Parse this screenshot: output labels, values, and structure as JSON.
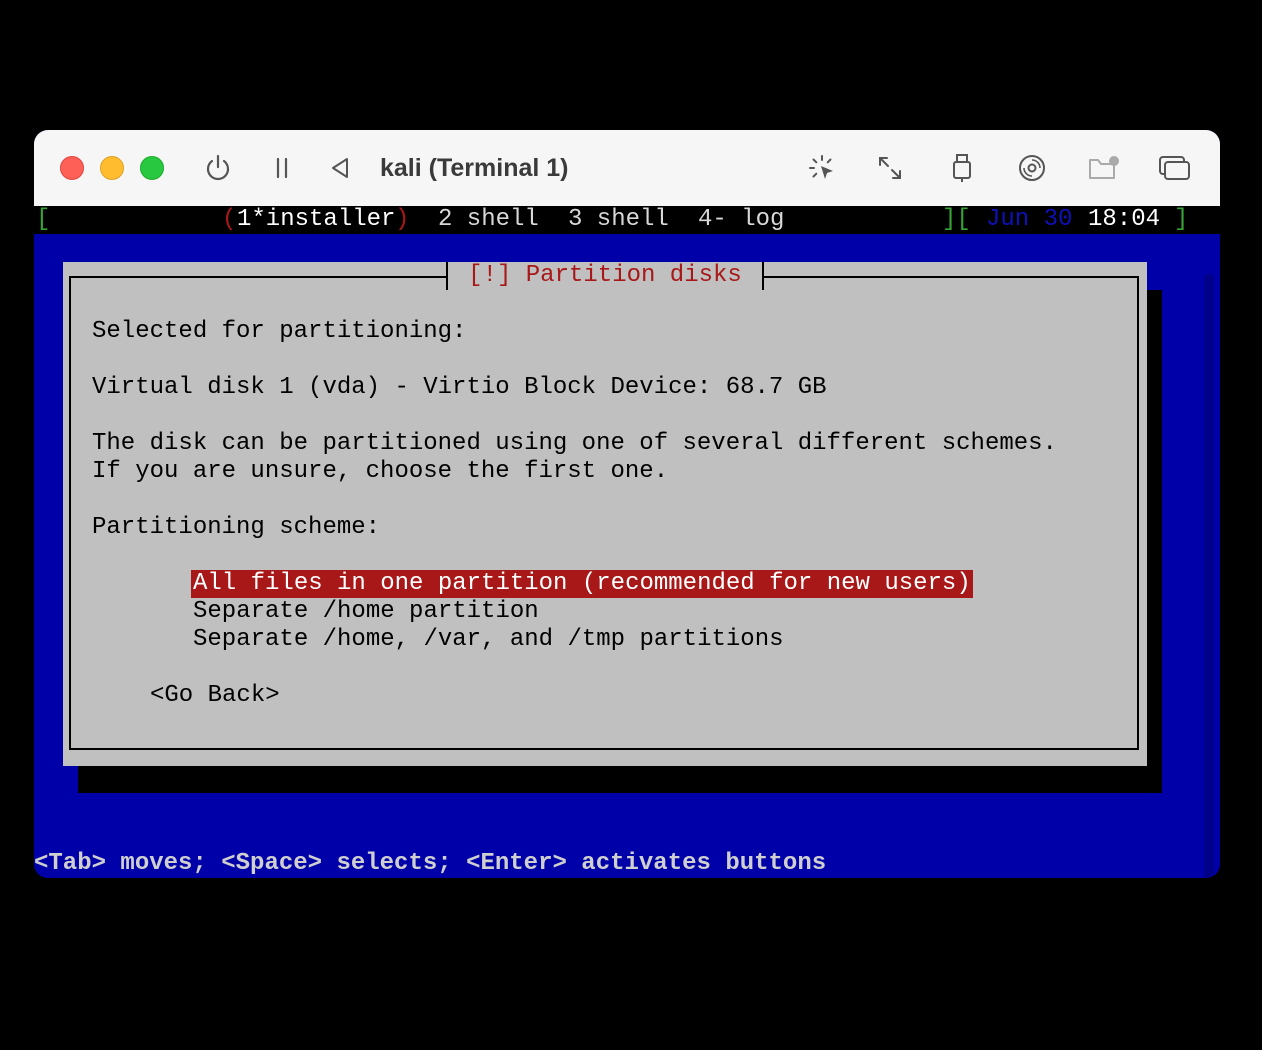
{
  "window": {
    "title": "kali (Terminal 1)",
    "toolbar_icons": [
      "power-icon",
      "pause-icon",
      "back-triangle-icon",
      "cursor-capture-icon",
      "resize-icon",
      "usb-icon",
      "disc-icon",
      "shared-folder-icon",
      "windows-icon"
    ]
  },
  "statusbar": {
    "bracket_open": "[",
    "tab1_open": "(",
    "tab1_label": "1*installer",
    "tab1_close": ")",
    "tab2": "2 shell",
    "tab3": "3 shell",
    "tab4": "4- log",
    "bracket_mid": "][",
    "date": "Jun 30",
    "time": "18:04",
    "bracket_close": "]"
  },
  "dialog": {
    "title": "[!] Partition disks",
    "selected_label": "Selected for partitioning:",
    "disk": "Virtual disk 1 (vda) - Virtio Block Device: 68.7 GB",
    "desc_line1": "The disk can be partitioned using one of several different schemes.",
    "desc_line2": "If you are unsure, choose the first one.",
    "scheme_label": "Partitioning scheme:",
    "options": [
      "All files in one partition (recommended for new users)",
      "Separate /home partition",
      "Separate /home, /var, and /tmp partitions"
    ],
    "selected_option": 0,
    "go_back": "<Go Back>"
  },
  "hint": "<Tab> moves; <Space> selects; <Enter> activates buttons",
  "colors": {
    "background": "#0000a8",
    "dialog": "#c0c0c0",
    "accent": "#a81818",
    "statusbar_green": "#36a336",
    "date_blue": "#1010b8"
  }
}
